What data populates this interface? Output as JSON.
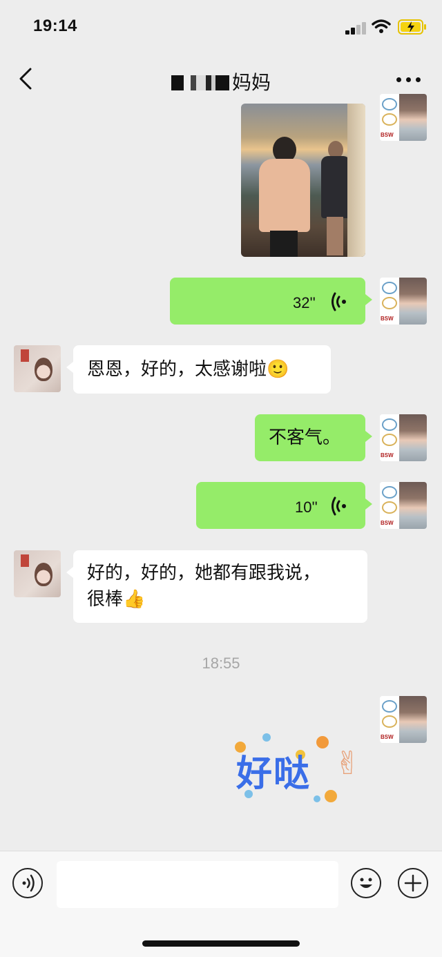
{
  "status_bar": {
    "time": "19:14",
    "signal_icon": "cellular-signal-icon",
    "wifi_icon": "wifi-icon",
    "battery_icon": "battery-charging-icon"
  },
  "header": {
    "title": "妈妈",
    "back_icon": "chevron-left-icon",
    "more_icon": "more-dots-icon"
  },
  "messages": [
    {
      "type": "image",
      "sender": "me"
    },
    {
      "type": "voice",
      "sender": "me",
      "duration": "32''"
    },
    {
      "type": "text",
      "sender": "other",
      "text": "恩恩，好的，太感谢啦🙂"
    },
    {
      "type": "text",
      "sender": "me",
      "text": "不客气。"
    },
    {
      "type": "voice",
      "sender": "me",
      "duration": "10''"
    },
    {
      "type": "text",
      "sender": "other",
      "line1": "好的，好的，她都有跟我说，",
      "line2": "很棒👍"
    },
    {
      "type": "timestamp",
      "text": "18:55"
    },
    {
      "type": "sticker",
      "sender": "me",
      "text": "好哒",
      "emoji": "✌"
    }
  ],
  "input_bar": {
    "voice_icon": "voice-input-icon",
    "text_value": "",
    "emoji_icon": "emoji-icon",
    "plus_icon": "plus-icon"
  },
  "colors": {
    "self_bubble": "#95ec69",
    "other_bubble": "#ffffff",
    "background": "#ededed"
  }
}
